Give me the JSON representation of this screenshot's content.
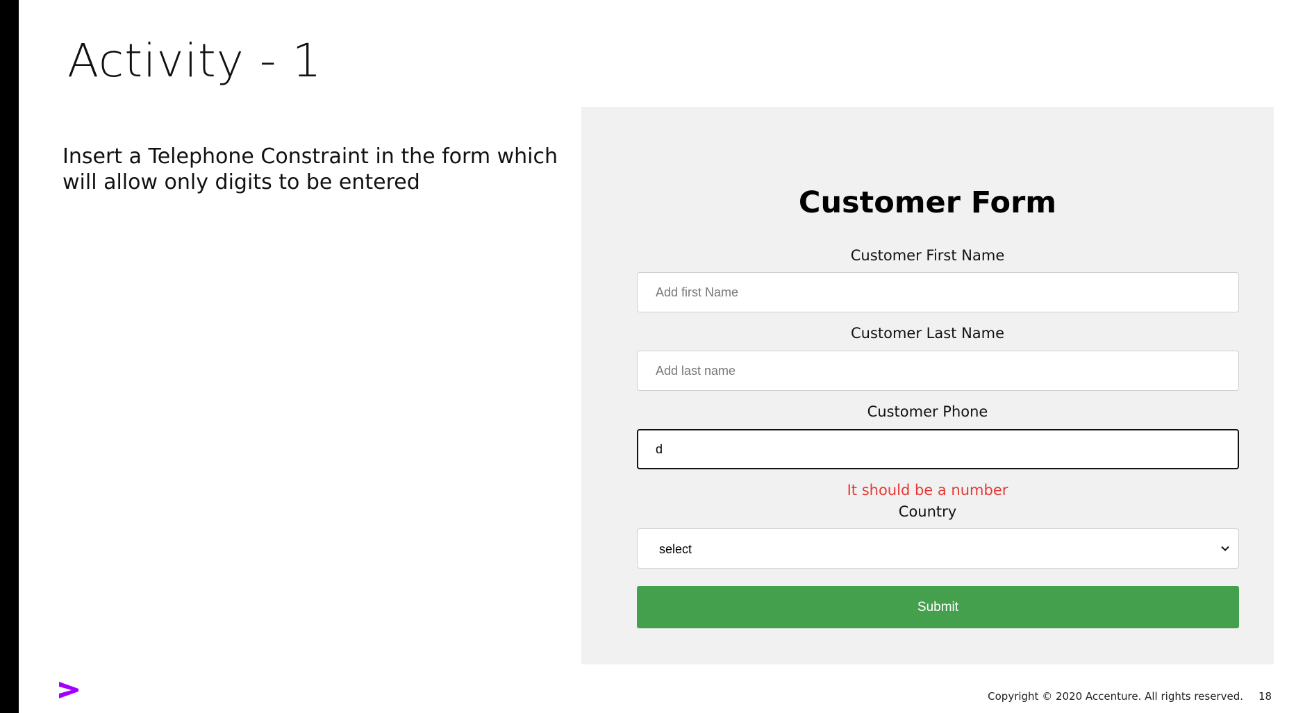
{
  "slide": {
    "title": "Activity - 1",
    "body": "Insert a Telephone Constraint in the form which will allow only digits to be entered"
  },
  "form": {
    "title": "Customer Form",
    "first_name": {
      "label": "Customer First Name",
      "placeholder": "Add first Name",
      "value": ""
    },
    "last_name": {
      "label": "Customer Last Name",
      "placeholder": "Add last name",
      "value": ""
    },
    "phone": {
      "label": "Customer Phone",
      "value": "d",
      "error": "It should be a number"
    },
    "country": {
      "label": "Country",
      "selected": "select"
    },
    "submit_label": "Submit"
  },
  "footer": {
    "copyright": "Copyright © 2020 Accenture. All rights reserved.",
    "page_number": "18"
  },
  "icons": {
    "logo": "accenture-greater-than-logo",
    "dropdown": "chevron-down-icon"
  },
  "colors": {
    "accent": "#a100ff",
    "submit_button": "#45a04d",
    "error": "#e53935",
    "panel_background": "#f1f1f1"
  }
}
